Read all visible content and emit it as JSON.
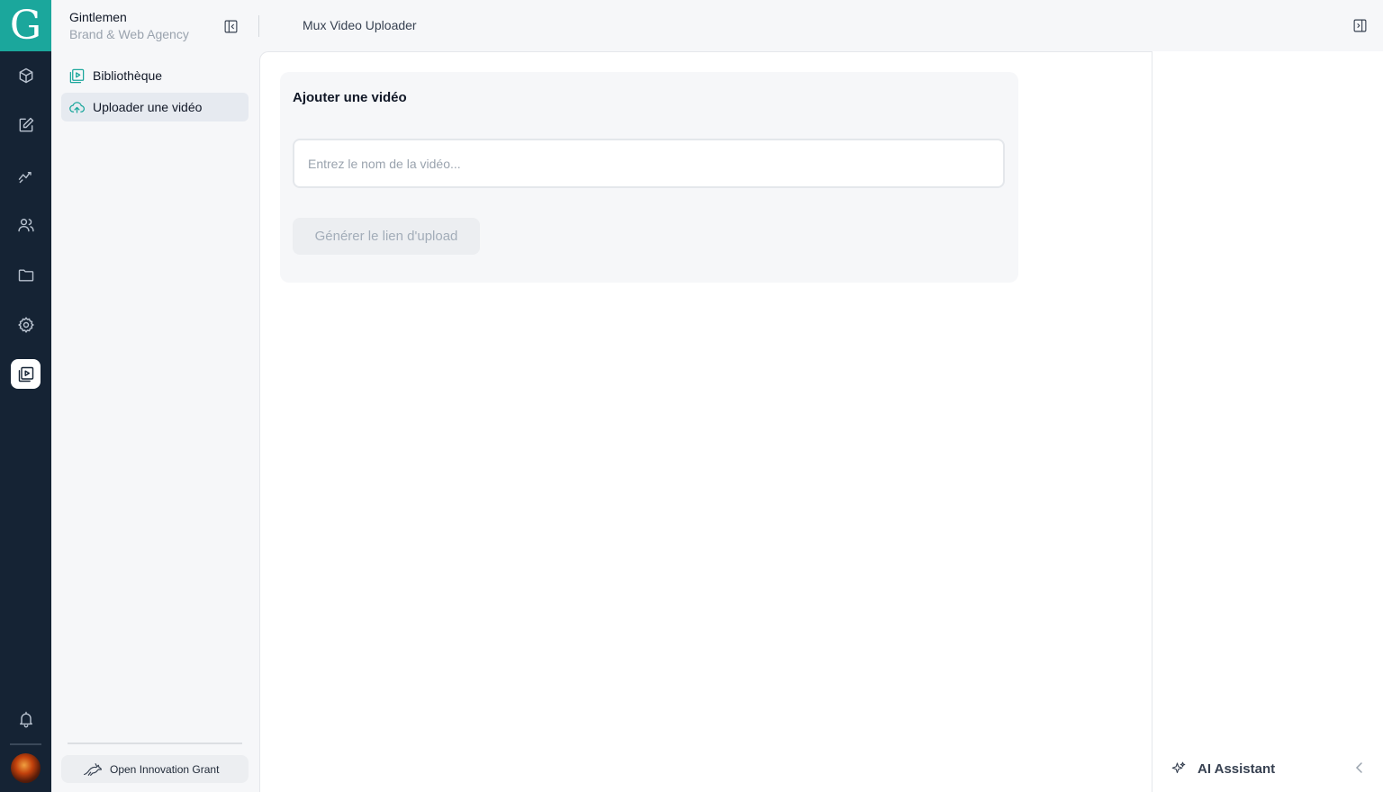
{
  "app": {
    "logo_letter": "G",
    "brand_name": "Gintlemen",
    "brand_subtitle": "Brand & Web Agency",
    "page_title": "Mux Video Uploader",
    "accent_color": "#1ba79c",
    "rail_color": "#152334"
  },
  "rail": {
    "icons": [
      "cube-icon",
      "edit-icon",
      "analytics-icon",
      "users-icon",
      "folder-icon",
      "settings-icon",
      "video-library-icon"
    ],
    "active": "video-library-icon",
    "bottom_icons": [
      "bell-icon",
      "avatar"
    ]
  },
  "sidebar": {
    "items": [
      {
        "label": "Bibliothèque",
        "icon": "video-library-icon",
        "active": false
      },
      {
        "label": "Uploader une vidéo",
        "icon": "cloud-upload-icon",
        "active": true
      }
    ],
    "footer_button": "Open Innovation Grant"
  },
  "card": {
    "title": "Ajouter une vidéo",
    "input_placeholder": "Entrez le nom de la vidéo...",
    "input_value": "",
    "button_label": "Générer le lien d'upload"
  },
  "assistant": {
    "label": "AI Assistant"
  }
}
